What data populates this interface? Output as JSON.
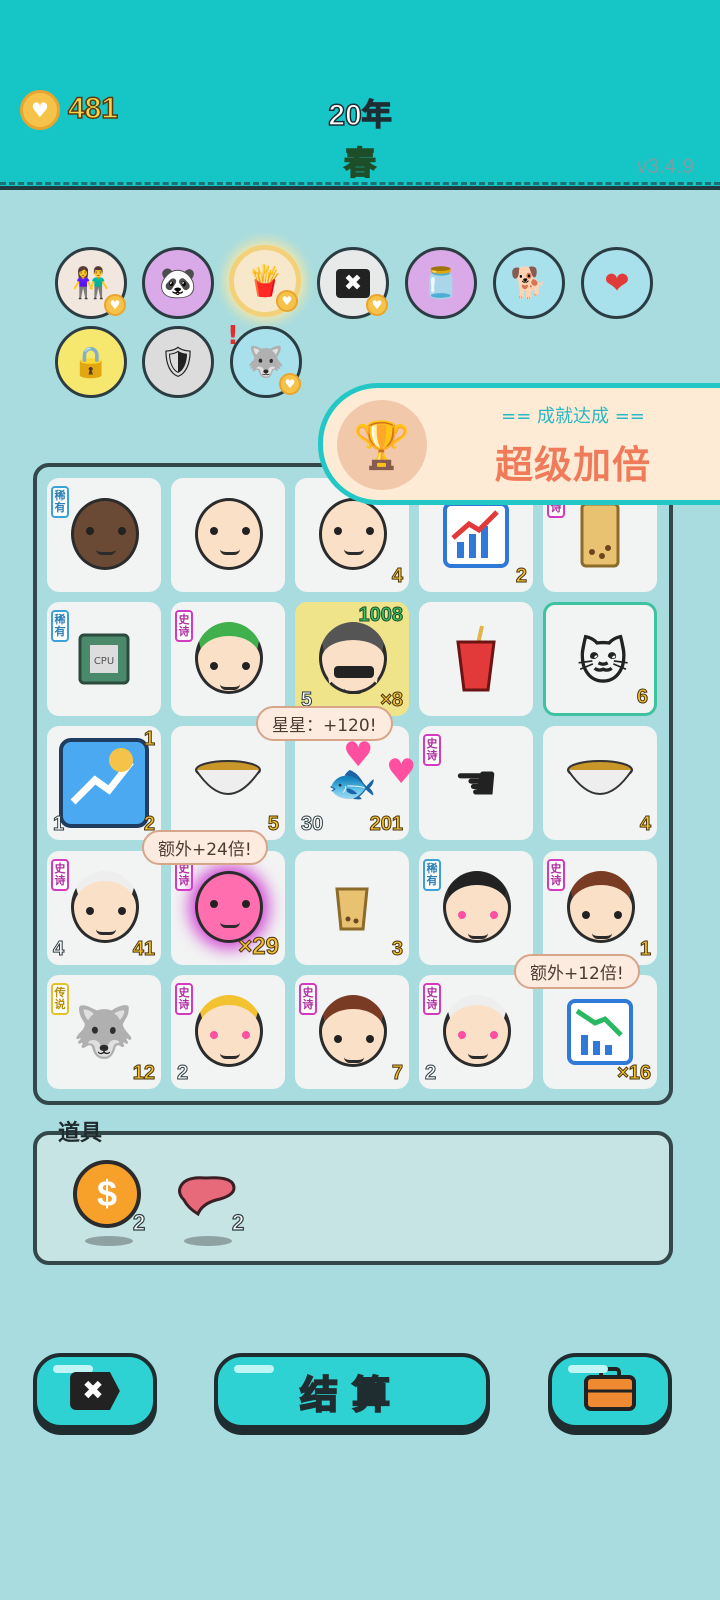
{
  "header": {
    "coins": "481",
    "year": "20年",
    "season": "春",
    "version": "v3.4.9"
  },
  "buffs": [
    {
      "name": "couple",
      "bg": "#f1e7de",
      "glyph": "👫"
    },
    {
      "name": "panda",
      "bg": "#d9a9e8",
      "glyph": "🐼"
    },
    {
      "name": "fries",
      "bg": "#f3e6cf",
      "glyph": "🍟"
    },
    {
      "name": "cancel-tag",
      "bg": "#e6e8e8",
      "glyph": "✖"
    },
    {
      "name": "jar",
      "bg": "#d9a9e8",
      "glyph": "🫙"
    },
    {
      "name": "dog",
      "bg": "#a8e0ec",
      "glyph": "🐕"
    },
    {
      "name": "heart-drip",
      "bg": "#a8e0ec",
      "glyph": "❤"
    },
    {
      "name": "safe",
      "bg": "#f6e86f",
      "glyph": "🔒"
    },
    {
      "name": "shield",
      "bg": "#dcdcdc",
      "glyph": "🛡"
    },
    {
      "name": "husky",
      "bg": "#a8e0ec",
      "glyph": "🐺"
    }
  ],
  "achievement": {
    "subtitle": "== 成就达成 ==",
    "title": "超级加倍"
  },
  "tags": {
    "rare": "稀有",
    "epic": "史诗",
    "legend": "传说"
  },
  "board": {
    "r1": {
      "c3": "4",
      "c4": "2"
    },
    "r2": {
      "c3_top": "1008",
      "c3_bl": "5",
      "c3_br": "×8",
      "c5": "6"
    },
    "r3": {
      "c1_tr": "1",
      "c1_bl": "1",
      "c1_br": "2",
      "c2": "5",
      "c3_bl": "30",
      "c3_br": "201",
      "c5": "4"
    },
    "r4": {
      "c1_bl": "4",
      "c1_br": "41",
      "c2": "×29",
      "c3": "3",
      "c5": "1"
    },
    "r5": {
      "c1": "12",
      "c2": "2",
      "c3": "7",
      "c4": "2",
      "c5": "×16"
    }
  },
  "bubbles": {
    "stars": "星星：+120!",
    "extra24": "额外+24倍!",
    "extra12": "额外+12倍!"
  },
  "props": {
    "title": "道具",
    "items": [
      {
        "name": "coin",
        "count": "2"
      },
      {
        "name": "liver",
        "count": "2"
      }
    ]
  },
  "buttons": {
    "settle": "结算"
  }
}
